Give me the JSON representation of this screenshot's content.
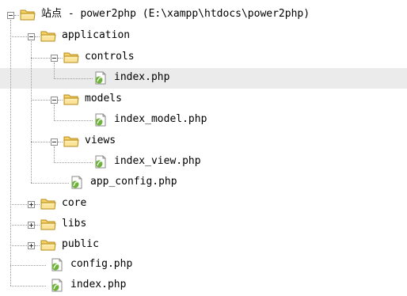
{
  "tree": [
    {
      "label": "站点 - power2php (E:\\xampp\\htdocs\\power2php)",
      "icon": "folder-icon",
      "expanded": true,
      "level": 0
    },
    {
      "label": "application",
      "icon": "folder-icon",
      "expanded": true,
      "level": 1
    },
    {
      "label": "controls",
      "icon": "folder-icon",
      "expanded": true,
      "level": 2
    },
    {
      "label": "index.php",
      "icon": "php-file-icon",
      "level": 3,
      "selected": true
    },
    {
      "label": "models",
      "icon": "folder-icon",
      "expanded": true,
      "level": 2
    },
    {
      "label": "index_model.php",
      "icon": "php-file-icon",
      "level": 3
    },
    {
      "label": "views",
      "icon": "folder-icon",
      "expanded": true,
      "level": 2
    },
    {
      "label": "index_view.php",
      "icon": "php-file-icon",
      "level": 3
    },
    {
      "label": "app_config.php",
      "icon": "php-file-icon",
      "level": 2
    },
    {
      "label": "core",
      "icon": "folder-icon",
      "expanded": false,
      "level": 1
    },
    {
      "label": "libs",
      "icon": "folder-icon",
      "expanded": false,
      "level": 1
    },
    {
      "label": "public",
      "icon": "folder-icon",
      "expanded": false,
      "level": 1
    },
    {
      "label": "config.php",
      "icon": "php-file-icon",
      "level": 1
    },
    {
      "label": "index.php",
      "icon": "php-file-icon",
      "level": 1
    }
  ],
  "colors": {
    "selection": "#ebebeb",
    "folder_fill": "#f6d26a",
    "folder_outline": "#b58a17",
    "php_badge": "#6fb43a"
  }
}
